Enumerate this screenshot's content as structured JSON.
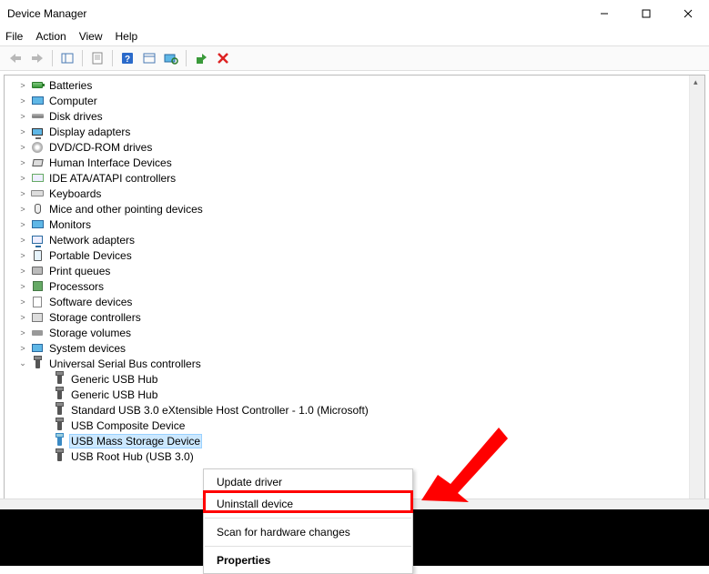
{
  "window": {
    "title": "Device Manager"
  },
  "menu": {
    "file": "File",
    "action": "Action",
    "view": "View",
    "help": "Help"
  },
  "tree": {
    "categories": [
      {
        "label": "Batteries",
        "icon": "battery"
      },
      {
        "label": "Computer",
        "icon": "monitor"
      },
      {
        "label": "Disk drives",
        "icon": "disk"
      },
      {
        "label": "Display adapters",
        "icon": "display"
      },
      {
        "label": "DVD/CD-ROM drives",
        "icon": "cd"
      },
      {
        "label": "Human Interface Devices",
        "icon": "hid"
      },
      {
        "label": "IDE ATA/ATAPI controllers",
        "icon": "ide"
      },
      {
        "label": "Keyboards",
        "icon": "keyboard"
      },
      {
        "label": "Mice and other pointing devices",
        "icon": "mouse"
      },
      {
        "label": "Monitors",
        "icon": "monitor"
      },
      {
        "label": "Network adapters",
        "icon": "network"
      },
      {
        "label": "Portable Devices",
        "icon": "portable"
      },
      {
        "label": "Print queues",
        "icon": "printer"
      },
      {
        "label": "Processors",
        "icon": "cpu"
      },
      {
        "label": "Software devices",
        "icon": "soft"
      },
      {
        "label": "Storage controllers",
        "icon": "storage"
      },
      {
        "label": "Storage volumes",
        "icon": "volume"
      },
      {
        "label": "System devices",
        "icon": "system"
      }
    ],
    "usb": {
      "label": "Universal Serial Bus controllers",
      "children": [
        {
          "label": "Generic USB Hub"
        },
        {
          "label": "Generic USB Hub"
        },
        {
          "label": "Standard USB 3.0 eXtensible Host Controller - 1.0 (Microsoft)"
        },
        {
          "label": "USB Composite Device"
        },
        {
          "label": "USB Mass Storage Device",
          "selected": true
        },
        {
          "label": "USB Root Hub (USB 3.0)"
        }
      ]
    }
  },
  "context_menu": {
    "update": "Update driver",
    "uninstall": "Uninstall device",
    "scan": "Scan for hardware changes",
    "properties": "Properties"
  },
  "annotation": {
    "highlighted_item": "Uninstall device"
  }
}
